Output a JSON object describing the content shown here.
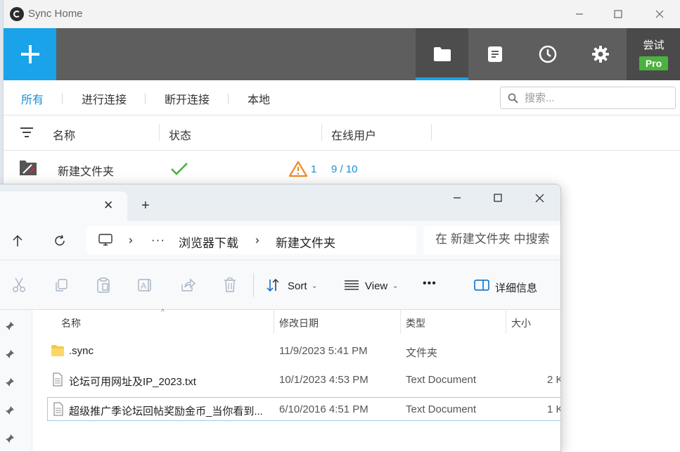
{
  "sync": {
    "app_title": "Sync Home",
    "pro_try": "尝试",
    "pro_badge": "Pro",
    "filters": [
      "所有",
      "进行连接",
      "断开连接",
      "本地"
    ],
    "search_placeholder": "搜索...",
    "columns": {
      "name": "名称",
      "status": "状态",
      "online": "在线用户"
    },
    "row": {
      "name": "新建文件夹",
      "warning_count": "1",
      "users": "9 / 10"
    },
    "colors": {
      "accent": "#1aa3e8",
      "toolbar": "#5e5e5e",
      "pro": "#4cb140",
      "ok": "#4cb140",
      "warn": "#f08a24"
    }
  },
  "explorer": {
    "tab_close": "✕",
    "new_tab": "+",
    "breadcrumb": {
      "more": "···",
      "parent": "浏览器下载",
      "current": "新建文件夹"
    },
    "search_placeholder": "在 新建文件夹 中搜索",
    "commands": {
      "sort": "Sort",
      "view": "View",
      "more": "•••",
      "details": "详细信息"
    },
    "list_headers": {
      "name": "名称",
      "modified": "修改日期",
      "type": "类型",
      "size": "大小"
    },
    "files": [
      {
        "name": ".sync",
        "modified": "11/9/2023 5:41 PM",
        "type": "文件夹",
        "size": "",
        "icon": "folder-icon"
      },
      {
        "name": "论坛可用网址及IP_2023.txt",
        "modified": "10/1/2023 4:53 PM",
        "type": "Text Document",
        "size": "2 K",
        "icon": "text-file-icon"
      },
      {
        "name": "超级推广季论坛回帖奖励金币_当你看到...",
        "modified": "6/10/2016 4:51 PM",
        "type": "Text Document",
        "size": "1 K",
        "icon": "text-file-icon"
      }
    ]
  }
}
